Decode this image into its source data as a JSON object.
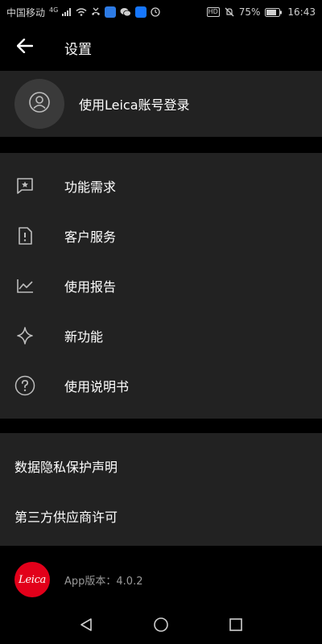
{
  "status_bar": {
    "carrier": "中国移动",
    "network_type": "4G",
    "battery": "75%",
    "time": "16:43",
    "hd": "HD"
  },
  "app_bar": {
    "title": "设置",
    "back_icon": "arrow-left-icon"
  },
  "login": {
    "label": "使用Leica账号登录",
    "icon": "user-circle-icon"
  },
  "menu": {
    "items": [
      {
        "label": "功能需求",
        "icon": "feedback-star-icon"
      },
      {
        "label": "客户服务",
        "icon": "document-alert-icon"
      },
      {
        "label": "使用报告",
        "icon": "line-chart-icon"
      },
      {
        "label": "新功能",
        "icon": "sparkle-icon"
      },
      {
        "label": "使用说明书",
        "icon": "help-circle-icon"
      }
    ]
  },
  "links": {
    "items": [
      {
        "label": "数据隐私保护声明"
      },
      {
        "label": "第三方供应商许可"
      }
    ]
  },
  "footer": {
    "logo_text": "Leica",
    "version": "App版本：4.0.2"
  },
  "colors": {
    "background": "#000000",
    "card": "#222222",
    "leica_red": "#e2001a",
    "muted_text": "#9a9a9a"
  }
}
